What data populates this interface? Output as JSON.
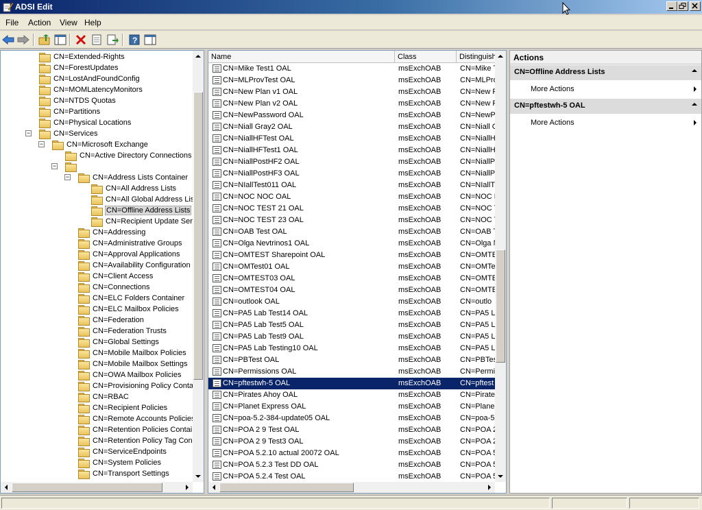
{
  "window": {
    "title": "ADSI Edit"
  },
  "menu": [
    "File",
    "Action",
    "View",
    "Help"
  ],
  "toolbar": [
    "back-icon",
    "forward-icon",
    "up-folder-icon",
    "show-hide-tree-icon",
    "delete-icon",
    "properties-icon",
    "export-list-icon",
    "help-icon",
    "show-hide-action-pane-icon"
  ],
  "tree": {
    "items": [
      {
        "label": "CN=Extended-Rights",
        "depth": 3
      },
      {
        "label": "CN=ForestUpdates",
        "depth": 3
      },
      {
        "label": "CN=LostAndFoundConfig",
        "depth": 3
      },
      {
        "label": "CN=MOMLatencyMonitors",
        "depth": 3
      },
      {
        "label": "CN=NTDS Quotas",
        "depth": 3
      },
      {
        "label": "CN=Partitions",
        "depth": 3
      },
      {
        "label": "CN=Physical Locations",
        "depth": 3
      },
      {
        "label": "CN=Services",
        "depth": 3,
        "toggle": "−"
      },
      {
        "label": "CN=Microsoft Exchange",
        "depth": 4,
        "toggle": "−"
      },
      {
        "label": "CN=Active Directory Connections",
        "depth": 5
      },
      {
        "label": "",
        "depth": 5,
        "toggle": "−"
      },
      {
        "label": "CN=Address Lists Container",
        "depth": 6,
        "toggle": "−"
      },
      {
        "label": "CN=All Address Lists",
        "depth": 7
      },
      {
        "label": "CN=All Global Address Lis",
        "depth": 7
      },
      {
        "label": "CN=Offline Address Lists",
        "depth": 7,
        "selected": true
      },
      {
        "label": "CN=Recipient Update Ser",
        "depth": 7
      },
      {
        "label": "CN=Addressing",
        "depth": 6
      },
      {
        "label": "CN=Administrative Groups",
        "depth": 6
      },
      {
        "label": "CN=Approval Applications",
        "depth": 6
      },
      {
        "label": "CN=Availability Configuration",
        "depth": 6
      },
      {
        "label": "CN=Client Access",
        "depth": 6
      },
      {
        "label": "CN=Connections",
        "depth": 6
      },
      {
        "label": "CN=ELC Folders Container",
        "depth": 6
      },
      {
        "label": "CN=ELC Mailbox Policies",
        "depth": 6
      },
      {
        "label": "CN=Federation",
        "depth": 6
      },
      {
        "label": "CN=Federation Trusts",
        "depth": 6
      },
      {
        "label": "CN=Global Settings",
        "depth": 6
      },
      {
        "label": "CN=Mobile Mailbox Policies",
        "depth": 6
      },
      {
        "label": "CN=Mobile Mailbox Settings",
        "depth": 6
      },
      {
        "label": "CN=OWA Mailbox Policies",
        "depth": 6
      },
      {
        "label": "CN=Provisioning Policy Conta",
        "depth": 6
      },
      {
        "label": "CN=RBAC",
        "depth": 6
      },
      {
        "label": "CN=Recipient Policies",
        "depth": 6
      },
      {
        "label": "CN=Remote Accounts Policies",
        "depth": 6
      },
      {
        "label": "CN=Retention Policies Contai",
        "depth": 6
      },
      {
        "label": "CN=Retention Policy Tag Con",
        "depth": 6
      },
      {
        "label": "CN=ServiceEndpoints",
        "depth": 6
      },
      {
        "label": "CN=System Policies",
        "depth": 6
      },
      {
        "label": "CN=Transport Settings",
        "depth": 6
      }
    ]
  },
  "list": {
    "columns": [
      "Name",
      "Class",
      "Distinguish"
    ],
    "rows": [
      {
        "name": "CN=Mike Test1 OAL",
        "class": "msExchOAB",
        "dn": "CN=Mike T"
      },
      {
        "name": "CN=MLProvTest OAL",
        "class": "msExchOAB",
        "dn": "CN=MLProv"
      },
      {
        "name": "CN=New Plan v1 OAL",
        "class": "msExchOAB",
        "dn": "CN=New P"
      },
      {
        "name": "CN=New Plan v2 OAL",
        "class": "msExchOAB",
        "dn": "CN=New P"
      },
      {
        "name": "CN=NewPassword OAL",
        "class": "msExchOAB",
        "dn": "CN=NewP"
      },
      {
        "name": "CN=Niall Gray2 OAL",
        "class": "msExchOAB",
        "dn": "CN=Niall G"
      },
      {
        "name": "CN=NiallHFTest OAL",
        "class": "msExchOAB",
        "dn": "CN=NiallH"
      },
      {
        "name": "CN=NiallHFTest1 OAL",
        "class": "msExchOAB",
        "dn": "CN=NiallH"
      },
      {
        "name": "CN=NiallPostHF2 OAL",
        "class": "msExchOAB",
        "dn": "CN=NiallP"
      },
      {
        "name": "CN=NiallPostHF3 OAL",
        "class": "msExchOAB",
        "dn": "CN=NiallP"
      },
      {
        "name": "CN=NIallTest011 OAL",
        "class": "msExchOAB",
        "dn": "CN=NIallT"
      },
      {
        "name": "CN=NOC NOC OAL",
        "class": "msExchOAB",
        "dn": "CN=NOC N"
      },
      {
        "name": "CN=NOC TEST 21 OAL",
        "class": "msExchOAB",
        "dn": "CN=NOC T"
      },
      {
        "name": "CN=NOC TEST 23 OAL",
        "class": "msExchOAB",
        "dn": "CN=NOC T"
      },
      {
        "name": "CN=OAB Test OAL",
        "class": "msExchOAB",
        "dn": "CN=OAB T"
      },
      {
        "name": "CN=Olga Nevtrinos1 OAL",
        "class": "msExchOAB",
        "dn": "CN=Olga N"
      },
      {
        "name": "CN=OMTEST Sharepoint OAL",
        "class": "msExchOAB",
        "dn": "CN=OMTE"
      },
      {
        "name": "CN=OMTest01 OAL",
        "class": "msExchOAB",
        "dn": "CN=OMTe"
      },
      {
        "name": "CN=OMTEST03 OAL",
        "class": "msExchOAB",
        "dn": "CN=OMTE"
      },
      {
        "name": "CN=OMTEST04 OAL",
        "class": "msExchOAB",
        "dn": "CN=OMTE"
      },
      {
        "name": "CN=outlook OAL",
        "class": "msExchOAB",
        "dn": "CN=outlo"
      },
      {
        "name": "CN=PA5 Lab Test14 OAL",
        "class": "msExchOAB",
        "dn": "CN=PA5 L"
      },
      {
        "name": "CN=PA5 Lab Test5 OAL",
        "class": "msExchOAB",
        "dn": "CN=PA5 L"
      },
      {
        "name": "CN=PA5 Lab Test9 OAL",
        "class": "msExchOAB",
        "dn": "CN=PA5 L"
      },
      {
        "name": "CN=PA5 Lab Testing10 OAL",
        "class": "msExchOAB",
        "dn": "CN=PA5 L"
      },
      {
        "name": "CN=PBTest OAL",
        "class": "msExchOAB",
        "dn": "CN=PBTes"
      },
      {
        "name": "CN=Permissions OAL",
        "class": "msExchOAB",
        "dn": "CN=Permi"
      },
      {
        "name": "CN=pftestwh-5 OAL",
        "class": "msExchOAB",
        "dn": "CN=pftest",
        "selected": true
      },
      {
        "name": "CN=Pirates Ahoy OAL",
        "class": "msExchOAB",
        "dn": "CN=Pirate"
      },
      {
        "name": "CN=Planet Express OAL",
        "class": "msExchOAB",
        "dn": "CN=Plane"
      },
      {
        "name": "CN=poa-5.2-384-update05 OAL",
        "class": "msExchOAB",
        "dn": "CN=poa-5"
      },
      {
        "name": "CN=POA 2 9 Test OAL",
        "class": "msExchOAB",
        "dn": "CN=POA 2"
      },
      {
        "name": "CN=POA 2 9 Test3 OAL",
        "class": "msExchOAB",
        "dn": "CN=POA 2"
      },
      {
        "name": "CN=POA 5.2.10 actual 20072 OAL",
        "class": "msExchOAB",
        "dn": "CN=POA 5"
      },
      {
        "name": "CN=POA 5.2.3 Test DD OAL",
        "class": "msExchOAB",
        "dn": "CN=POA 5"
      },
      {
        "name": "CN=POA 5.2.4 Test OAL",
        "class": "msExchOAB",
        "dn": "CN=POA 5"
      }
    ]
  },
  "actions": {
    "title": "Actions",
    "sections": [
      {
        "title": "CN=Offline Address Lists",
        "items": [
          "More Actions"
        ]
      },
      {
        "title": "CN=pftestwh-5 OAL",
        "items": [
          "More Actions"
        ]
      }
    ]
  }
}
